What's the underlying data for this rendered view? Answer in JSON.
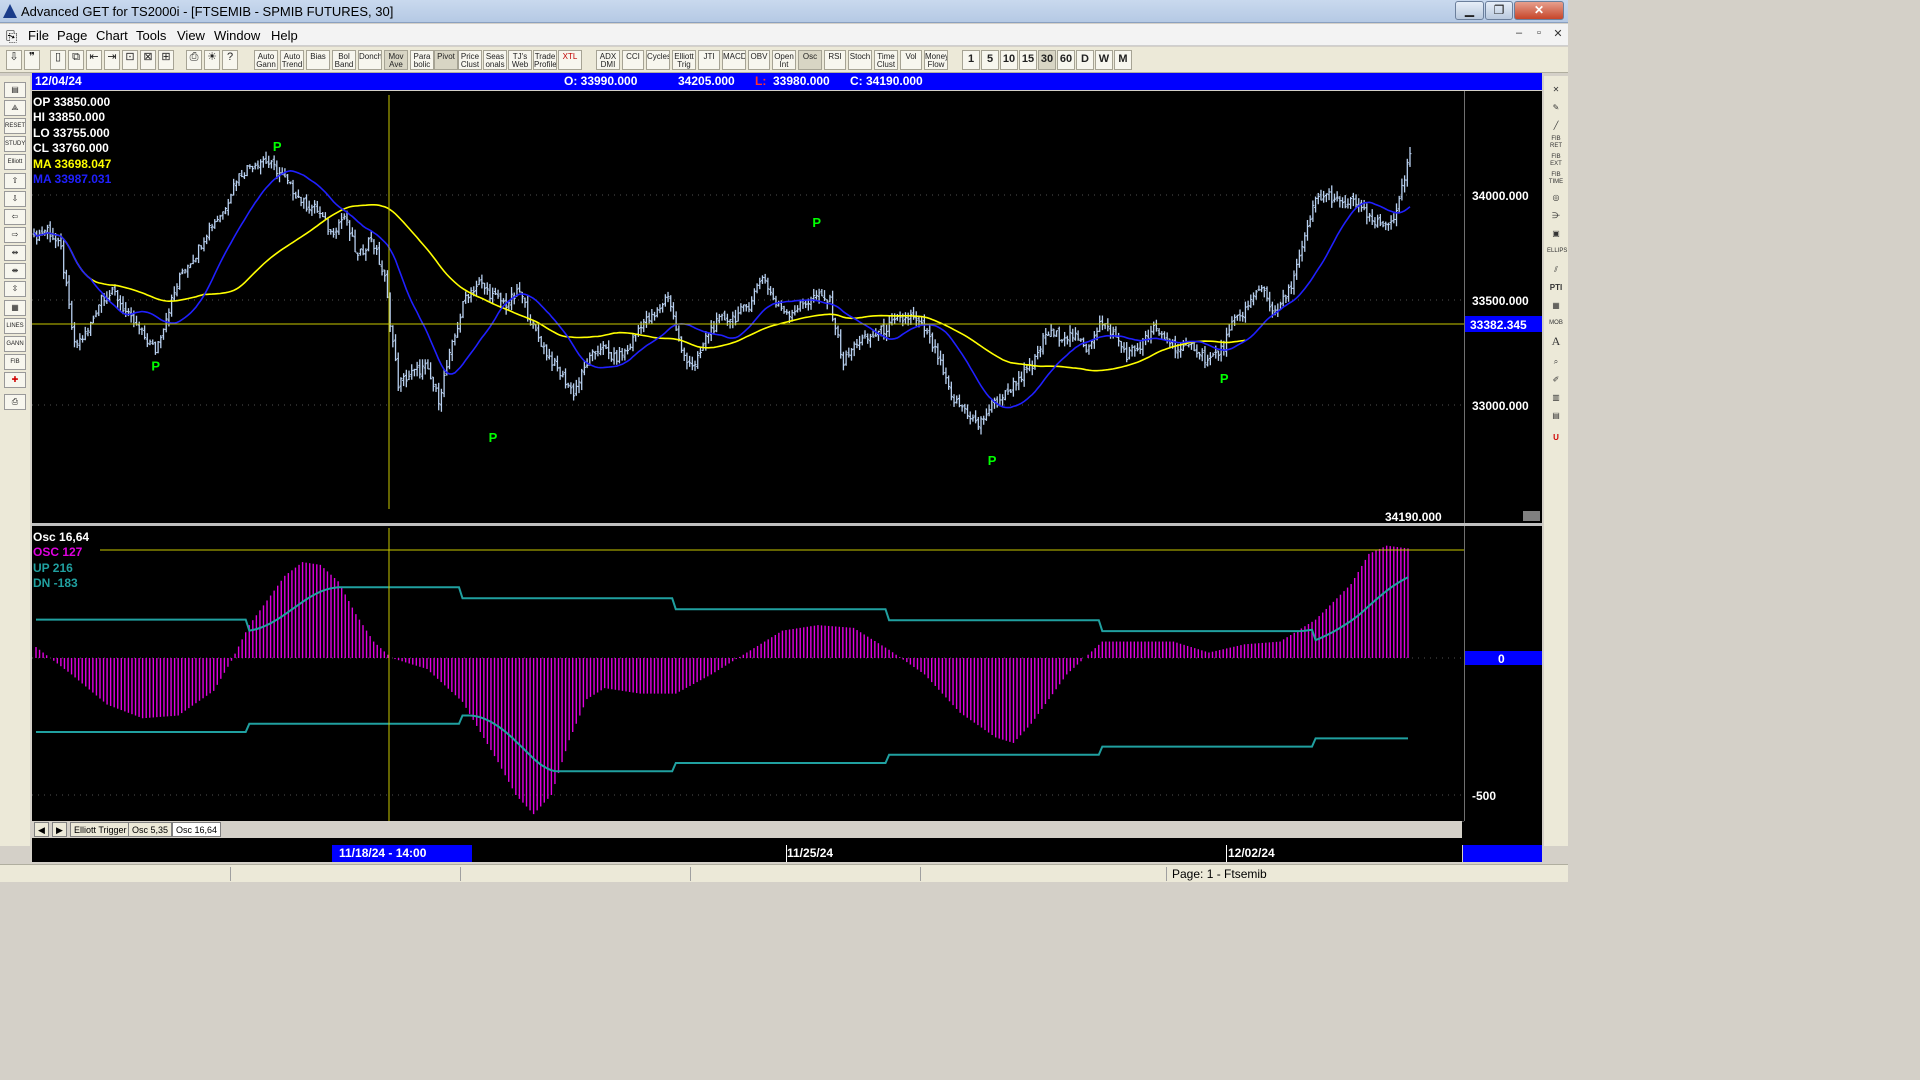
{
  "window": {
    "title": "Advanced GET for TS2000i - [FTSEMIB - SPMIB FUTURES, 30]",
    "minimize_icon": "minimize-icon",
    "maximize_icon": "maximize-icon",
    "close_icon": "close-icon"
  },
  "menu": {
    "items": [
      "File",
      "Page",
      "Chart",
      "Tools",
      "View",
      "Window",
      "Help"
    ],
    "mdi_buttons": [
      "–",
      "▫",
      "✕"
    ]
  },
  "toolbar": {
    "indicators": [
      "Auto Gann",
      "Auto Trend",
      "Bias",
      "Bol Band",
      "Donch",
      "Mov Ave",
      "Para bolic",
      "Pivot",
      "Price Clust",
      "Seas onals",
      "TJ's Web",
      "Trade Profile",
      "XTL",
      "ADX DMI",
      "CCI",
      "Cycles",
      "Elliott Trig",
      "JTI",
      "MACD",
      "OBV",
      "Open Int",
      "Osc",
      "RSI",
      "Stoch",
      "Time Clust",
      "Vol",
      "Money Flow"
    ],
    "intervals": [
      "1",
      "5",
      "10",
      "15",
      "30",
      "60",
      "D",
      "W",
      "M"
    ],
    "active_interval": "30"
  },
  "left_tools": [
    "open-icon",
    "chart-icon",
    "RESET",
    "STUDY",
    "Elliott",
    "up-arrow-icon",
    "down-arrow-icon",
    "left-arrow-icon",
    "right-arrow-icon",
    "expand-icon",
    "compress-h-icon",
    "compress-v-icon",
    "grid-icon",
    "LINES",
    "GANN",
    "FIB",
    "crosshair-icon",
    "print-icon"
  ],
  "right_tools": [
    "close-icon",
    "pencil-icon",
    "line-icon",
    "FIB RET",
    "FIB EXT",
    "FIB TIME",
    "cycle-icon",
    "fan-icon",
    "box-icon",
    "ELLIPS",
    "channel-icon",
    "PTI",
    "grid-icon",
    "MOB",
    "A",
    "zoom-icon",
    "paint-icon",
    "ruler-icon",
    "table-icon",
    "magnet-icon"
  ],
  "infobar": {
    "date": "12/04/24",
    "open": "O: 33990.000",
    "high": "34205.000",
    "low_label": "L:",
    "low": "33980.000",
    "close": "C: 34190.000"
  },
  "price_legend": {
    "op": "OP  33850.000",
    "hi": "HI   33850.000",
    "lo": "LO  33755.000",
    "cl": "CL  33760.000",
    "ma1": "MA  33698.047",
    "ma2": "MA  33987.031"
  },
  "price_axis": {
    "labels": [
      "34000.000",
      "33500.000",
      "33000.000"
    ],
    "crosshair_value": "33382.345",
    "last_value": "34190.000"
  },
  "pivot_label": "P",
  "osc_legend": {
    "title": "Osc 16,64",
    "osc": "OSC 127",
    "up": "UP   216",
    "dn": "DN   -183"
  },
  "osc_axis": {
    "zero": "0",
    "minus500": "-500"
  },
  "tabs": [
    "Elliott Trigger",
    "Osc 5,35",
    "Osc 16,64"
  ],
  "active_tab": "Osc 16,64",
  "datebar": {
    "selected": "11/18/24 - 14:00",
    "d2": "11/25/24",
    "d3": "12/02/24"
  },
  "status": {
    "page": "Page: 1 - Ftsemib"
  },
  "colors": {
    "bars": "#b8d0f0",
    "ma_yellow": "#ffff00",
    "ma_blue": "#2020ff",
    "osc": "#e000e0",
    "bands": "#20a0a0",
    "pivot": "#00ff00",
    "crosshair": "#c8c800",
    "accent": "#0000ff"
  },
  "chart_data": [
    {
      "type": "candlestick",
      "title": "FTSEMIB - SPMIB FUTURES, 30",
      "x_labels": [
        "11/18/24 - 14:00",
        "11/25/24",
        "12/02/24"
      ],
      "ylim": [
        32650,
        34400
      ],
      "y_ticks": [
        33000,
        33500,
        34000
      ],
      "close_path": [
        [
          0,
          33800
        ],
        [
          5,
          33840
        ],
        [
          10,
          33740
        ],
        [
          15,
          33280
        ],
        [
          20,
          33350
        ],
        [
          25,
          33520
        ],
        [
          30,
          33530
        ],
        [
          35,
          33420
        ],
        [
          40,
          33340
        ],
        [
          45,
          33260
        ],
        [
          50,
          33460
        ],
        [
          55,
          33640
        ],
        [
          60,
          33720
        ],
        [
          65,
          33850
        ],
        [
          70,
          33920
        ],
        [
          75,
          34080
        ],
        [
          80,
          34140
        ],
        [
          85,
          34170
        ],
        [
          90,
          34120
        ],
        [
          95,
          34040
        ],
        [
          100,
          33960
        ],
        [
          105,
          33930
        ],
        [
          110,
          33820
        ],
        [
          115,
          33900
        ],
        [
          120,
          33700
        ],
        [
          125,
          33800
        ],
        [
          130,
          33600
        ],
        [
          135,
          33100
        ],
        [
          140,
          33150
        ],
        [
          145,
          33180
        ],
        [
          150,
          33030
        ],
        [
          155,
          33280
        ],
        [
          160,
          33520
        ],
        [
          165,
          33580
        ],
        [
          170,
          33520
        ],
        [
          175,
          33480
        ],
        [
          180,
          33540
        ],
        [
          185,
          33370
        ],
        [
          190,
          33250
        ],
        [
          195,
          33150
        ],
        [
          200,
          33060
        ],
        [
          205,
          33200
        ],
        [
          210,
          33280
        ],
        [
          215,
          33220
        ],
        [
          220,
          33260
        ],
        [
          225,
          33390
        ],
        [
          230,
          33420
        ],
        [
          235,
          33530
        ],
        [
          240,
          33250
        ],
        [
          245,
          33180
        ],
        [
          250,
          33350
        ],
        [
          255,
          33410
        ],
        [
          260,
          33420
        ],
        [
          265,
          33480
        ],
        [
          270,
          33620
        ],
        [
          275,
          33480
        ],
        [
          280,
          33440
        ],
        [
          285,
          33480
        ],
        [
          290,
          33520
        ],
        [
          295,
          33490
        ],
        [
          300,
          33200
        ],
        [
          305,
          33300
        ],
        [
          310,
          33320
        ],
        [
          315,
          33360
        ],
        [
          320,
          33400
        ],
        [
          325,
          33420
        ],
        [
          330,
          33360
        ],
        [
          335,
          33230
        ],
        [
          340,
          33030
        ],
        [
          345,
          32980
        ],
        [
          350,
          32900
        ],
        [
          355,
          33000
        ],
        [
          360,
          33050
        ],
        [
          365,
          33130
        ],
        [
          370,
          33180
        ],
        [
          375,
          33340
        ],
        [
          380,
          33330
        ],
        [
          385,
          33330
        ],
        [
          390,
          33270
        ],
        [
          395,
          33390
        ],
        [
          400,
          33340
        ],
        [
          405,
          33240
        ],
        [
          410,
          33280
        ],
        [
          415,
          33360
        ],
        [
          420,
          33310
        ],
        [
          425,
          33260
        ],
        [
          430,
          33280
        ],
        [
          435,
          33210
        ],
        [
          440,
          33260
        ],
        [
          445,
          33400
        ],
        [
          450,
          33470
        ],
        [
          455,
          33570
        ],
        [
          460,
          33430
        ],
        [
          465,
          33540
        ],
        [
          470,
          33740
        ],
        [
          475,
          33980
        ],
        [
          480,
          34000
        ],
        [
          485,
          33950
        ],
        [
          490,
          33970
        ],
        [
          495,
          33880
        ],
        [
          500,
          33850
        ],
        [
          505,
          33910
        ],
        [
          510,
          34190
        ]
      ],
      "series": [
        {
          "name": "MA 33698.047",
          "color": "#ffff00"
        },
        {
          "name": "MA 33987.031",
          "color": "#2020ff"
        }
      ],
      "pivots": [
        {
          "label": "P",
          "kind": "low",
          "price": 33240
        },
        {
          "label": "P",
          "kind": "high",
          "price": 34180
        },
        {
          "label": "P",
          "kind": "low",
          "price": 32900
        },
        {
          "label": "P",
          "kind": "high",
          "price": 33820
        },
        {
          "label": "P",
          "kind": "low",
          "price": 32790
        },
        {
          "label": "P",
          "kind": "low",
          "price": 33180
        }
      ],
      "horizontal_line": 33382.345
    },
    {
      "type": "bar",
      "title": "Osc 16,64",
      "ylim": [
        -560,
        450
      ],
      "y_ticks": [
        0,
        -500
      ],
      "osc_path": [
        [
          0,
          40
        ],
        [
          10,
          -60
        ],
        [
          20,
          -170
        ],
        [
          30,
          -220
        ],
        [
          40,
          -210
        ],
        [
          50,
          -120
        ],
        [
          55,
          -10
        ],
        [
          60,
          120
        ],
        [
          70,
          300
        ],
        [
          75,
          350
        ],
        [
          80,
          340
        ],
        [
          85,
          280
        ],
        [
          90,
          160
        ],
        [
          95,
          60
        ],
        [
          100,
          0
        ],
        [
          110,
          -40
        ],
        [
          120,
          -160
        ],
        [
          130,
          -380
        ],
        [
          135,
          -500
        ],
        [
          140,
          -570
        ],
        [
          145,
          -500
        ],
        [
          150,
          -300
        ],
        [
          155,
          -150
        ],
        [
          160,
          -110
        ],
        [
          170,
          -130
        ],
        [
          180,
          -130
        ],
        [
          190,
          -60
        ],
        [
          200,
          20
        ],
        [
          210,
          100
        ],
        [
          220,
          120
        ],
        [
          230,
          110
        ],
        [
          240,
          30
        ],
        [
          250,
          -60
        ],
        [
          260,
          -200
        ],
        [
          270,
          -290
        ],
        [
          275,
          -310
        ],
        [
          280,
          -240
        ],
        [
          290,
          -60
        ],
        [
          300,
          60
        ],
        [
          310,
          60
        ],
        [
          320,
          60
        ],
        [
          330,
          20
        ],
        [
          340,
          50
        ],
        [
          350,
          60
        ],
        [
          360,
          140
        ],
        [
          370,
          270
        ],
        [
          375,
          380
        ],
        [
          380,
          410
        ],
        [
          386,
          400
        ]
      ],
      "series": [
        {
          "name": "OSC 127",
          "color": "#e000e0"
        },
        {
          "name": "UP 216",
          "color": "#20a0a0"
        },
        {
          "name": "DN -183",
          "color": "#20a0a0"
        }
      ]
    }
  ]
}
